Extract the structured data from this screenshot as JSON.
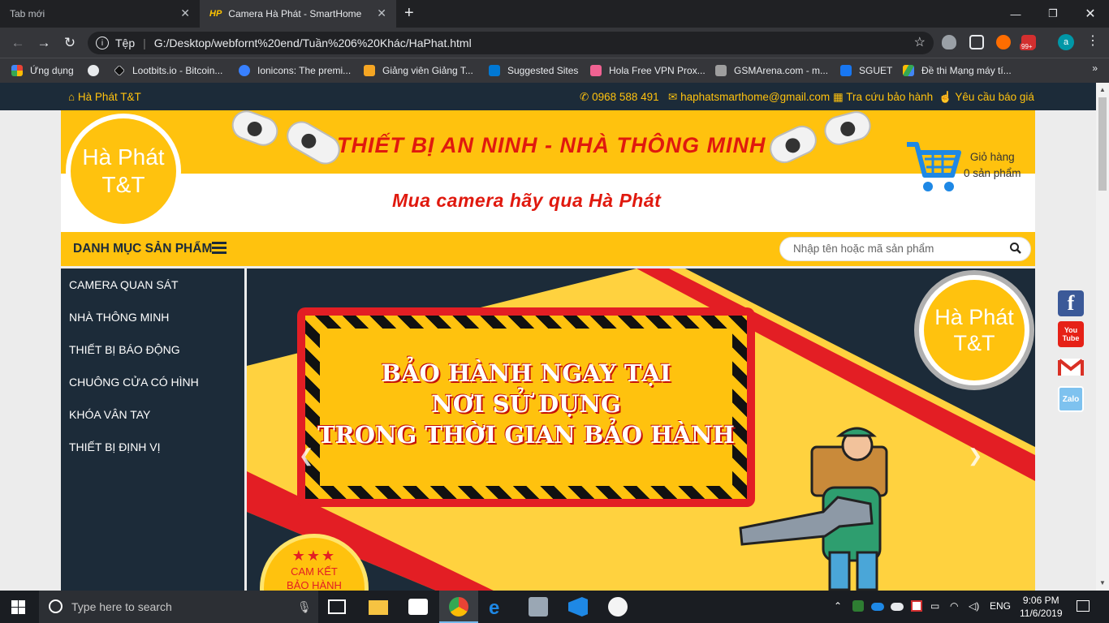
{
  "browser": {
    "tabs": [
      {
        "label": "Tab mới",
        "active": false
      },
      {
        "label": "Camera Hà Phát - SmartHome",
        "active": true,
        "favicon": "HP"
      }
    ],
    "address": {
      "security_label": "Tệp",
      "url": "G:/Desktop/webfornt%20end/Tuần%206%20Khác/HaPhat.html"
    },
    "bookmarks": [
      {
        "label": "Ứng dụng",
        "icon": "apps-grid-icon"
      },
      {
        "label": "",
        "icon": "globe-icon"
      },
      {
        "label": "Lootbits.io - Bitcoin...",
        "icon": "lootbits-icon"
      },
      {
        "label": "Ionicons: The premi...",
        "icon": "ionicons-icon"
      },
      {
        "label": "Giảng viên Giảng T...",
        "icon": "udemy-icon"
      },
      {
        "label": "Suggested Sites",
        "icon": "bing-icon"
      },
      {
        "label": "Hola Free VPN Prox...",
        "icon": "hola-icon"
      },
      {
        "label": "GSMArena.com - m...",
        "icon": "gsmarena-icon"
      },
      {
        "label": "SGUET",
        "icon": "facebook-icon"
      },
      {
        "label": "Đề thi Mạng máy tí...",
        "icon": "drive-icon"
      }
    ],
    "ext_badge": "99+",
    "avatar_letter": "a"
  },
  "site": {
    "topbar": {
      "brand": "Hà Phát T&T",
      "phone": "0968 588 491",
      "email": "haphatsmarthome@gmail.com",
      "warranty_lookup": "Tra cứu bảo hành",
      "quote_request": "Yêu cầu báo giá"
    },
    "header": {
      "logo_line1": "Hà Phát",
      "logo_line2": "T&T",
      "slogan_main": "THIẾT BỊ AN NINH - NHÀ THÔNG MINH",
      "slogan_sub": "Mua camera hãy qua Hà Phát",
      "cart_label": "Giỏ hàng",
      "cart_count": "0 sản phẩm"
    },
    "menu": {
      "title": "DANH MỤC SẢN PHẨM",
      "search_placeholder": "Nhập tên hoặc mã sản phẩm"
    },
    "categories": [
      "CAMERA QUAN SÁT",
      "NHÀ THÔNG MINH",
      "THIẾT BỊ BÁO ĐỘNG",
      "CHUÔNG CỬA CÓ HÌNH",
      "KHÓA VÂN TAY",
      "THIẾT BỊ ĐỊNH VỊ"
    ],
    "banner": {
      "line1": "BẢO HÀNH NGAY TẠI",
      "line2": "NƠI SỬ DỤNG",
      "line3": "TRONG THỜI GIAN BẢO HÀNH",
      "logo_line1": "Hà Phát",
      "logo_line2": "T&T",
      "badge_stars": "★★★",
      "badge_line1": "CAM KẾT",
      "badge_line2": "BẢO HÀNH"
    },
    "social": [
      "facebook-icon",
      "youtube-icon",
      "gmail-icon",
      "zalo-icon"
    ],
    "social_labels": {
      "youtube": "You Tube",
      "zalo": "Zalo"
    }
  },
  "taskbar": {
    "search_placeholder": "Type here to search",
    "language": "ENG",
    "time": "9:06 PM",
    "date": "11/6/2019"
  },
  "colors": {
    "accent_yellow": "#ffc20e",
    "navy": "#1c2b39",
    "red": "#e31e24"
  }
}
